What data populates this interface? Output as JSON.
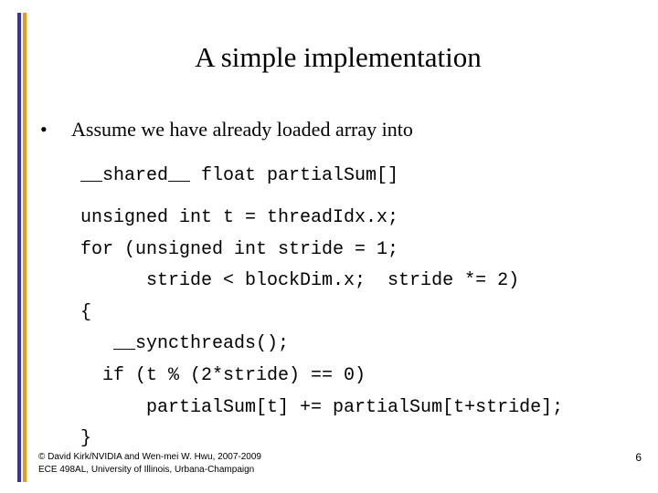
{
  "slide": {
    "title": "A simple implementation",
    "page_number": "6",
    "accent_colors": {
      "bar_blue": "#3333a3",
      "bar_orange": "#e8981c"
    },
    "bullet": {
      "marker": "•",
      "text": "Assume we have already loaded array into"
    },
    "code": {
      "declaration": "__shared__ float partialSum[]",
      "lines": [
        "unsigned int t = threadIdx.x;",
        "for (unsigned int stride = 1;",
        "      stride < blockDim.x;  stride *= 2)",
        "{",
        "   __syncthreads();",
        "  if (t % (2*stride) == 0)",
        "      partialSum[t] += partialSum[t+stride];",
        "}"
      ]
    },
    "footer": {
      "line1": "© David Kirk/NVIDIA and Wen-mei W. Hwu, 2007-2009",
      "line2": "ECE 498AL, University of Illinois, Urbana-Champaign"
    }
  }
}
